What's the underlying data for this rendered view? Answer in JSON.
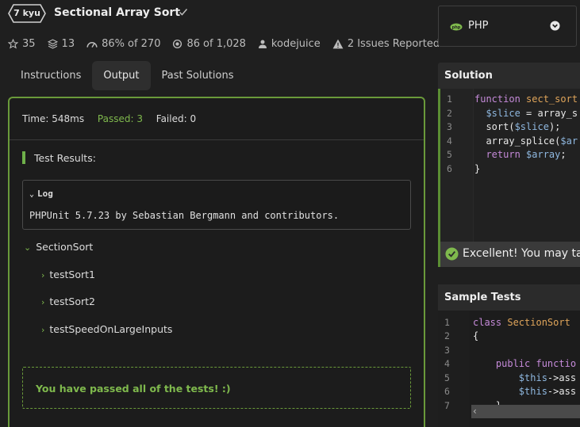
{
  "header": {
    "rank": "7 kyu",
    "title": "Sectional Array Sort"
  },
  "stats": {
    "stars": "35",
    "collections": "13",
    "satisfaction": "86%",
    "satisfaction_of": "of 270",
    "completed": "86",
    "completed_of": "of 1,028",
    "author": "kodejuice",
    "issues": "2 Issues Reported"
  },
  "tabs": [
    "Instructions",
    "Output",
    "Past Solutions"
  ],
  "output": {
    "time": "Time: 548ms",
    "passed": "Passed: 3",
    "failed": "Failed: 0",
    "test_results": "Test Results:",
    "log_label": "Log",
    "log_text": "PHPUnit 5.7.23 by Sebastian Bergmann and contributors.",
    "suite": "SectionSort",
    "tests": [
      "testSort1",
      "testSort2",
      "testSpeedOnLargeInputs"
    ],
    "pass_message": "You have passed all of the tests! :)"
  },
  "language": {
    "selected": "PHP"
  },
  "solution": {
    "heading": "Solution",
    "line_numbers": [
      "1",
      "2",
      "3",
      "4",
      "5",
      "6"
    ],
    "lines": [
      {
        "a": "function",
        "b": " sect_sort",
        "c": ""
      },
      {
        "a": "  $slice",
        "b": " = array_s",
        "c": ""
      },
      {
        "a": "  sort(",
        "b": "$slice",
        "c": ");"
      },
      {
        "a": "  array_splice(",
        "b": "$ar",
        "c": ""
      },
      {
        "a": "  return",
        "b": " $array",
        "c": ";"
      },
      {
        "a": "}",
        "b": "",
        "c": ""
      }
    ],
    "success_message": "Excellent! You may take"
  },
  "sample_tests": {
    "heading": "Sample Tests",
    "line_numbers": [
      "1",
      "2",
      "3",
      "4",
      "5",
      "6",
      "7"
    ],
    "lines": [
      {
        "a": "class",
        "b": " SectionSort",
        "c": ""
      },
      {
        "a": "{",
        "b": "",
        "c": ""
      },
      {
        "a": "",
        "b": "",
        "c": ""
      },
      {
        "a": "    public",
        "b": " functio",
        "c": ""
      },
      {
        "a": "        $this",
        "b": "->ass",
        "c": ""
      },
      {
        "a": "        $this",
        "b": "->ass",
        "c": ""
      },
      {
        "a": "    }",
        "b": "",
        "c": ""
      }
    ]
  },
  "colors": {
    "accent_green": "#7fb94d",
    "border_green": "#6a9a3a",
    "background": "#1f1f1f"
  }
}
